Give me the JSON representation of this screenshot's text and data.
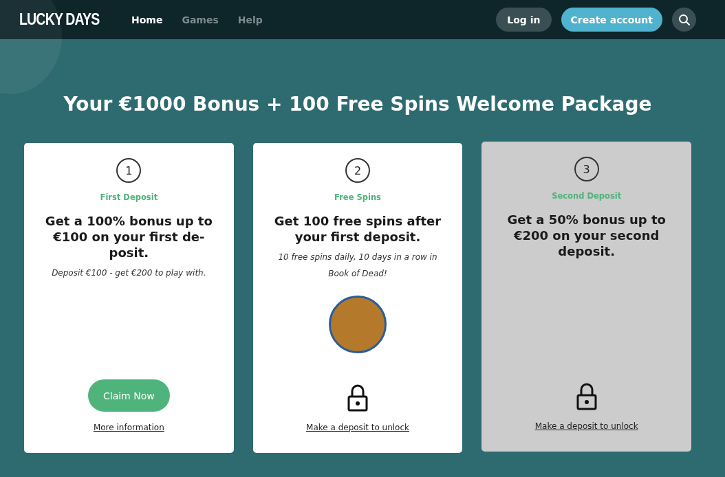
{
  "header": {
    "logo": "LUCKY DAYS",
    "nav": [
      {
        "label": "Home",
        "selected": true
      },
      {
        "label": "Games",
        "selected": false
      },
      {
        "label": "Help",
        "selected": false
      }
    ],
    "login": "Log in",
    "create_account": "Create account"
  },
  "title": "Your €1000 Bonus + 100 Free Spins Welcome Package",
  "cards": [
    {
      "number": "1",
      "label": "First Deposit",
      "heading": "Get a 100% bonus up to €100 on your first de-posit.",
      "description": "Deposit €100 - get €200 to play with.",
      "kind": "claim",
      "disabled": false,
      "button": "Claim Now",
      "link": "More information"
    },
    {
      "number": "2",
      "label": "Free Spins",
      "heading": "Get 100 free spins after your first deposit.",
      "description": "10 free spins daily, 10 days in a row in Book of Dead!",
      "game_logo": true,
      "kind": "locked",
      "disabled": false,
      "link": "Make a deposit to unlock"
    },
    {
      "number": "3",
      "label": "Second Deposit",
      "heading": "Get a 50% bonus up to €200 on your second deposit.",
      "kind": "locked",
      "disabled": true,
      "link": "Make a deposit to unlock"
    }
  ]
}
